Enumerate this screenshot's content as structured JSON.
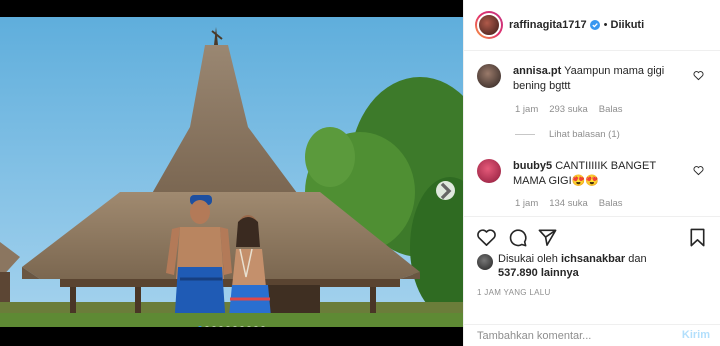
{
  "post": {
    "header": {
      "username": "raffinagita1717",
      "separator": "•",
      "follow_label": "Diikuti"
    },
    "comments": [
      {
        "username": "annisa.pt",
        "text": "Yaampun mama gigi bening bgttt",
        "time": "1 jam",
        "likes": "293 suka",
        "reply_label": "Balas",
        "view_replies": "Lihat balasan (1)"
      },
      {
        "username": "buuby5",
        "text": "CANTIIIIIK BANGET MAMA GIGI😍😍",
        "time": "1 jam",
        "likes": "134 suka",
        "reply_label": "Balas"
      }
    ],
    "likes_summary": {
      "prefix": "Disukai oleh",
      "liker": "ichsanakbar",
      "conj": "dan",
      "count": "537.890",
      "suffix": "lainnya"
    },
    "timestamp": "1 JAM YANG LALU",
    "add_comment": {
      "placeholder": "Tambahkan komentar...",
      "post_label": "Kirim"
    },
    "carousel": {
      "total": 10,
      "active_index": 0
    }
  },
  "colors": {
    "accent": "#3897f0",
    "post_disabled": "#b2dffc",
    "muted": "#8e8e8e",
    "text": "#262626"
  }
}
